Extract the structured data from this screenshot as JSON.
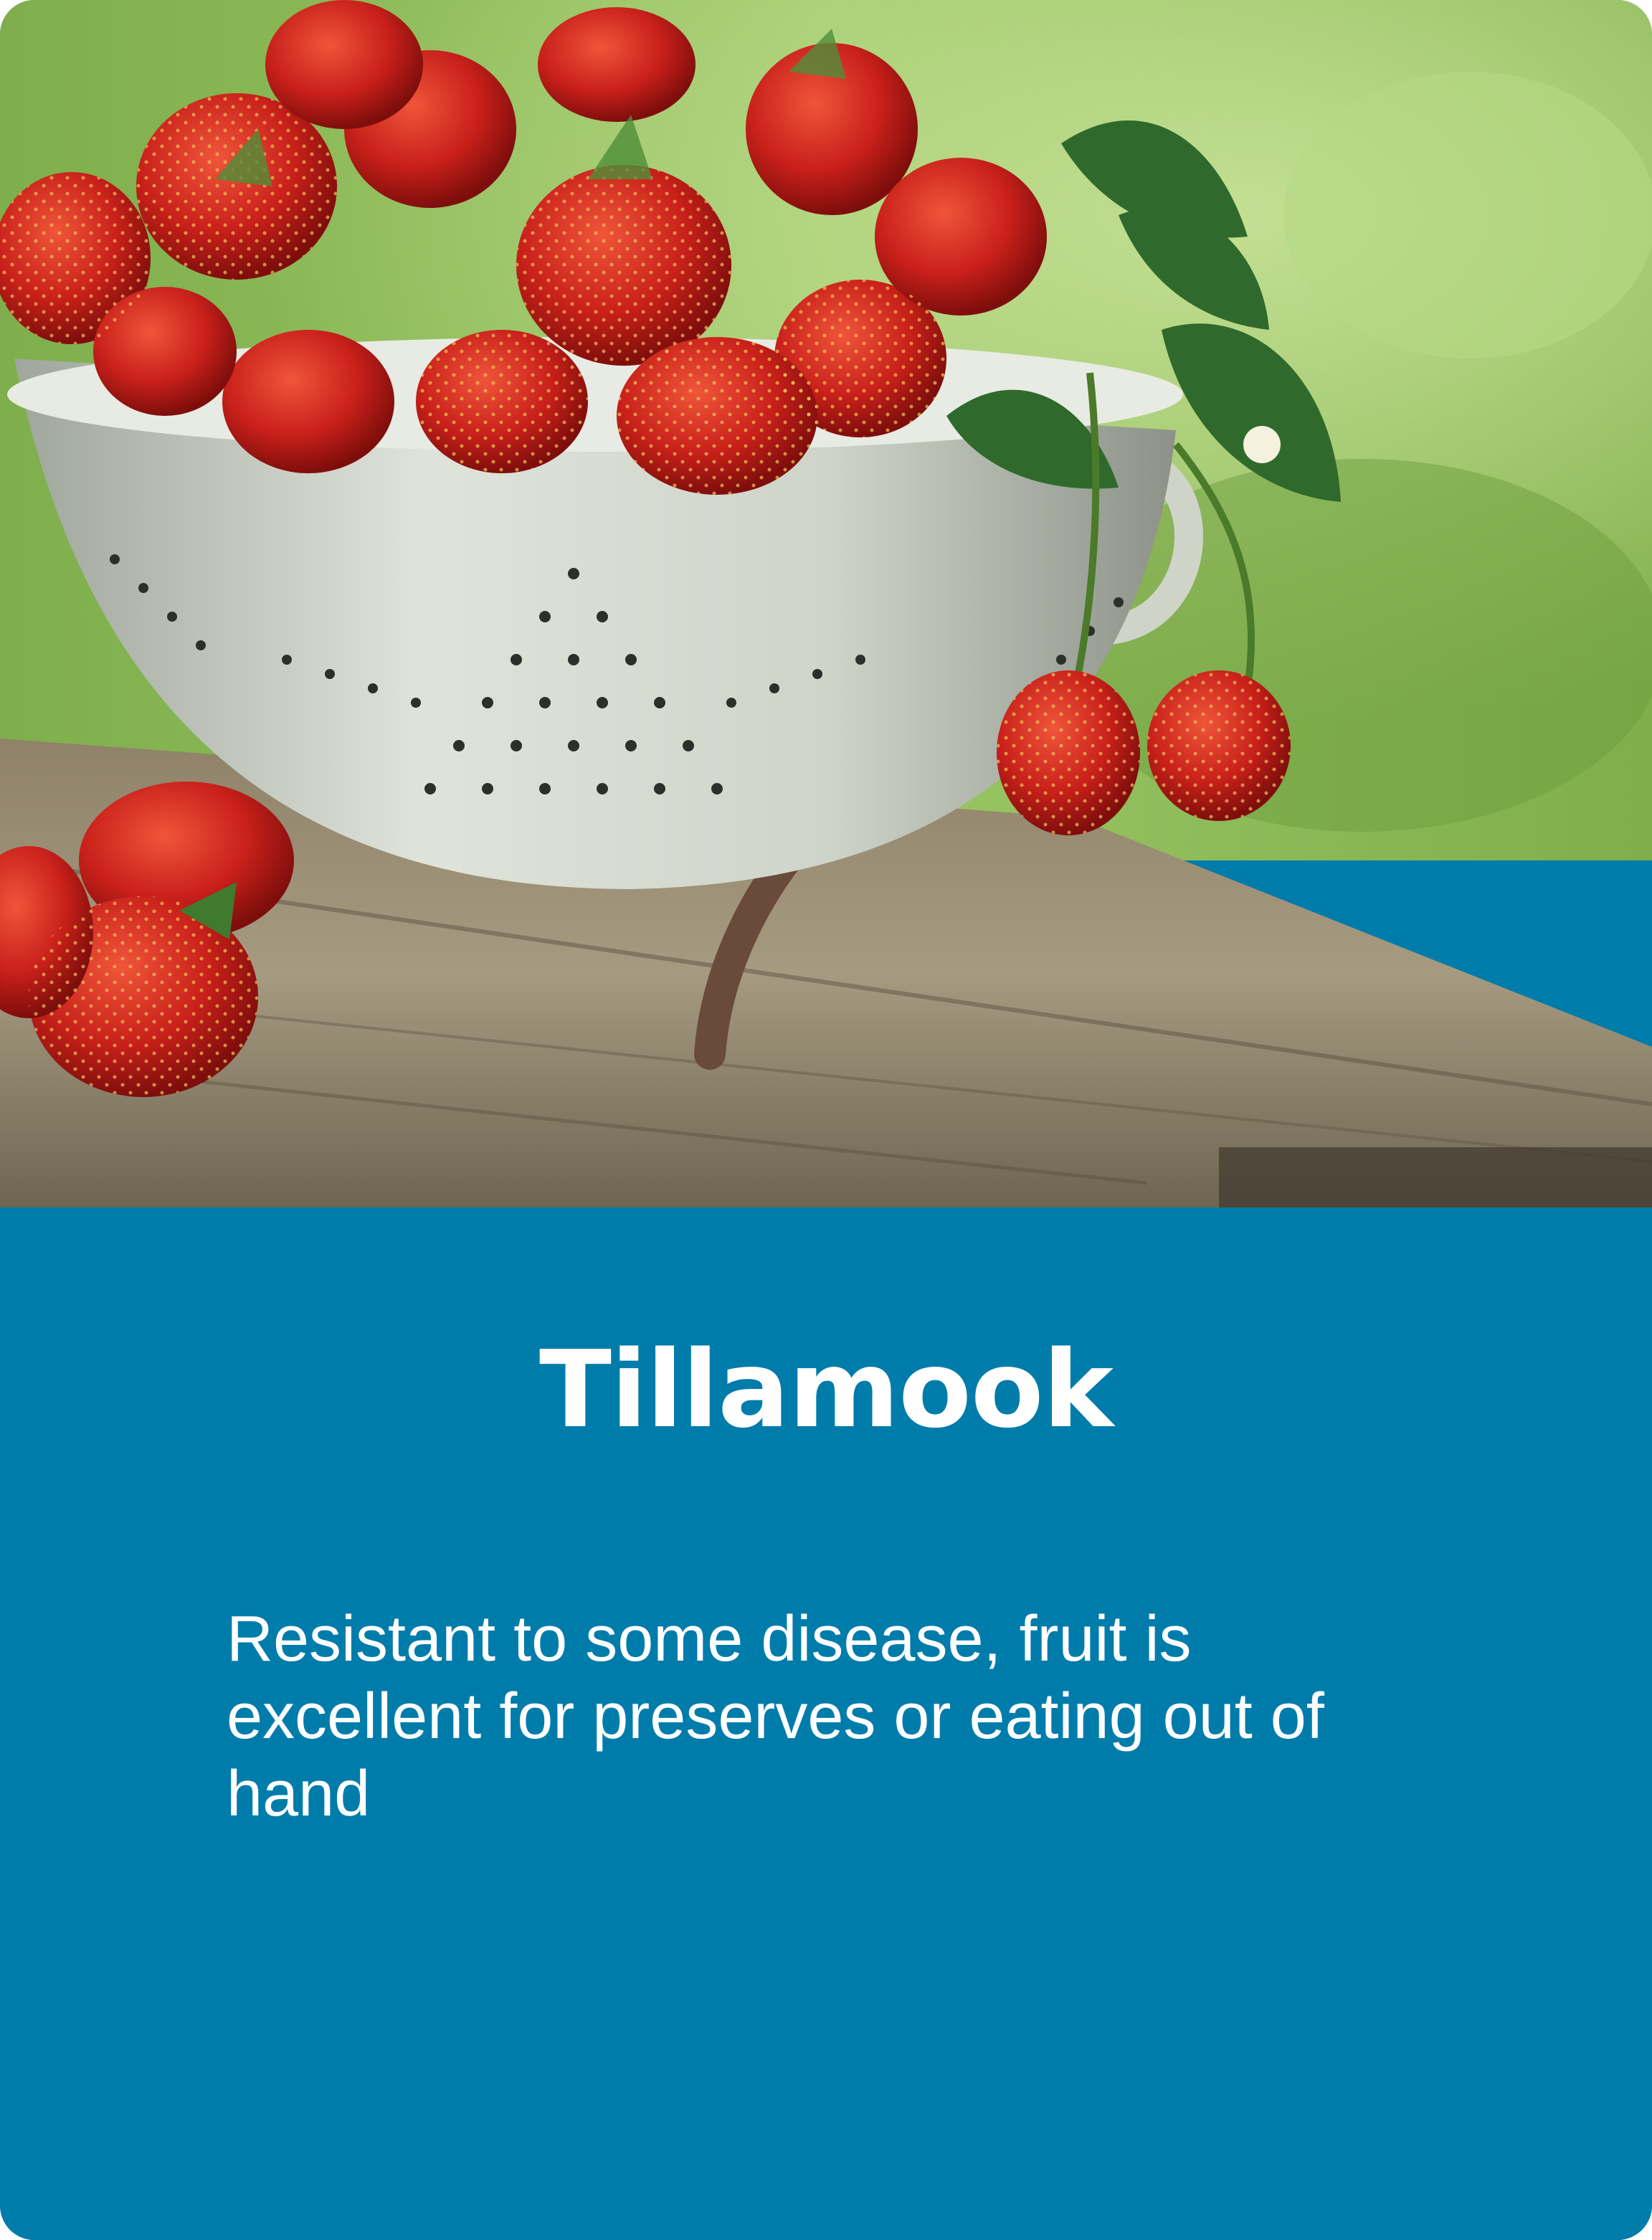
{
  "card": {
    "image_alt": "Strawberries in a white colander on a wooden table",
    "title": "Tillamook",
    "description": "Resistant to some disease, fruit is excellent for preserves or eating out of hand"
  },
  "colors": {
    "panel": "#007cab",
    "text": "#ffffff"
  }
}
